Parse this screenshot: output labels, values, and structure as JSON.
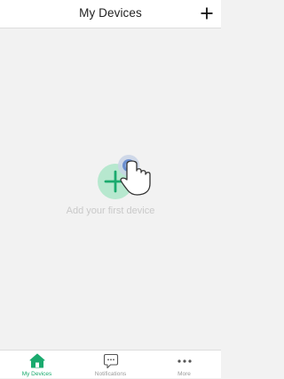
{
  "header": {
    "title": "My Devices",
    "add_icon": "plus-icon"
  },
  "empty_state": {
    "message": "Add your first device",
    "illustration": "add-device-hand-tap-icon"
  },
  "tabs": [
    {
      "label": "My Devices",
      "icon": "home-icon",
      "active": true
    },
    {
      "label": "Notifications",
      "icon": "chat-bubble-icon",
      "active": false
    },
    {
      "label": "More",
      "icon": "more-dots-icon",
      "active": false
    }
  ],
  "colors": {
    "accent": "#1aaa6e",
    "background": "#f2f2f2",
    "inactive": "#9a9a9a"
  }
}
